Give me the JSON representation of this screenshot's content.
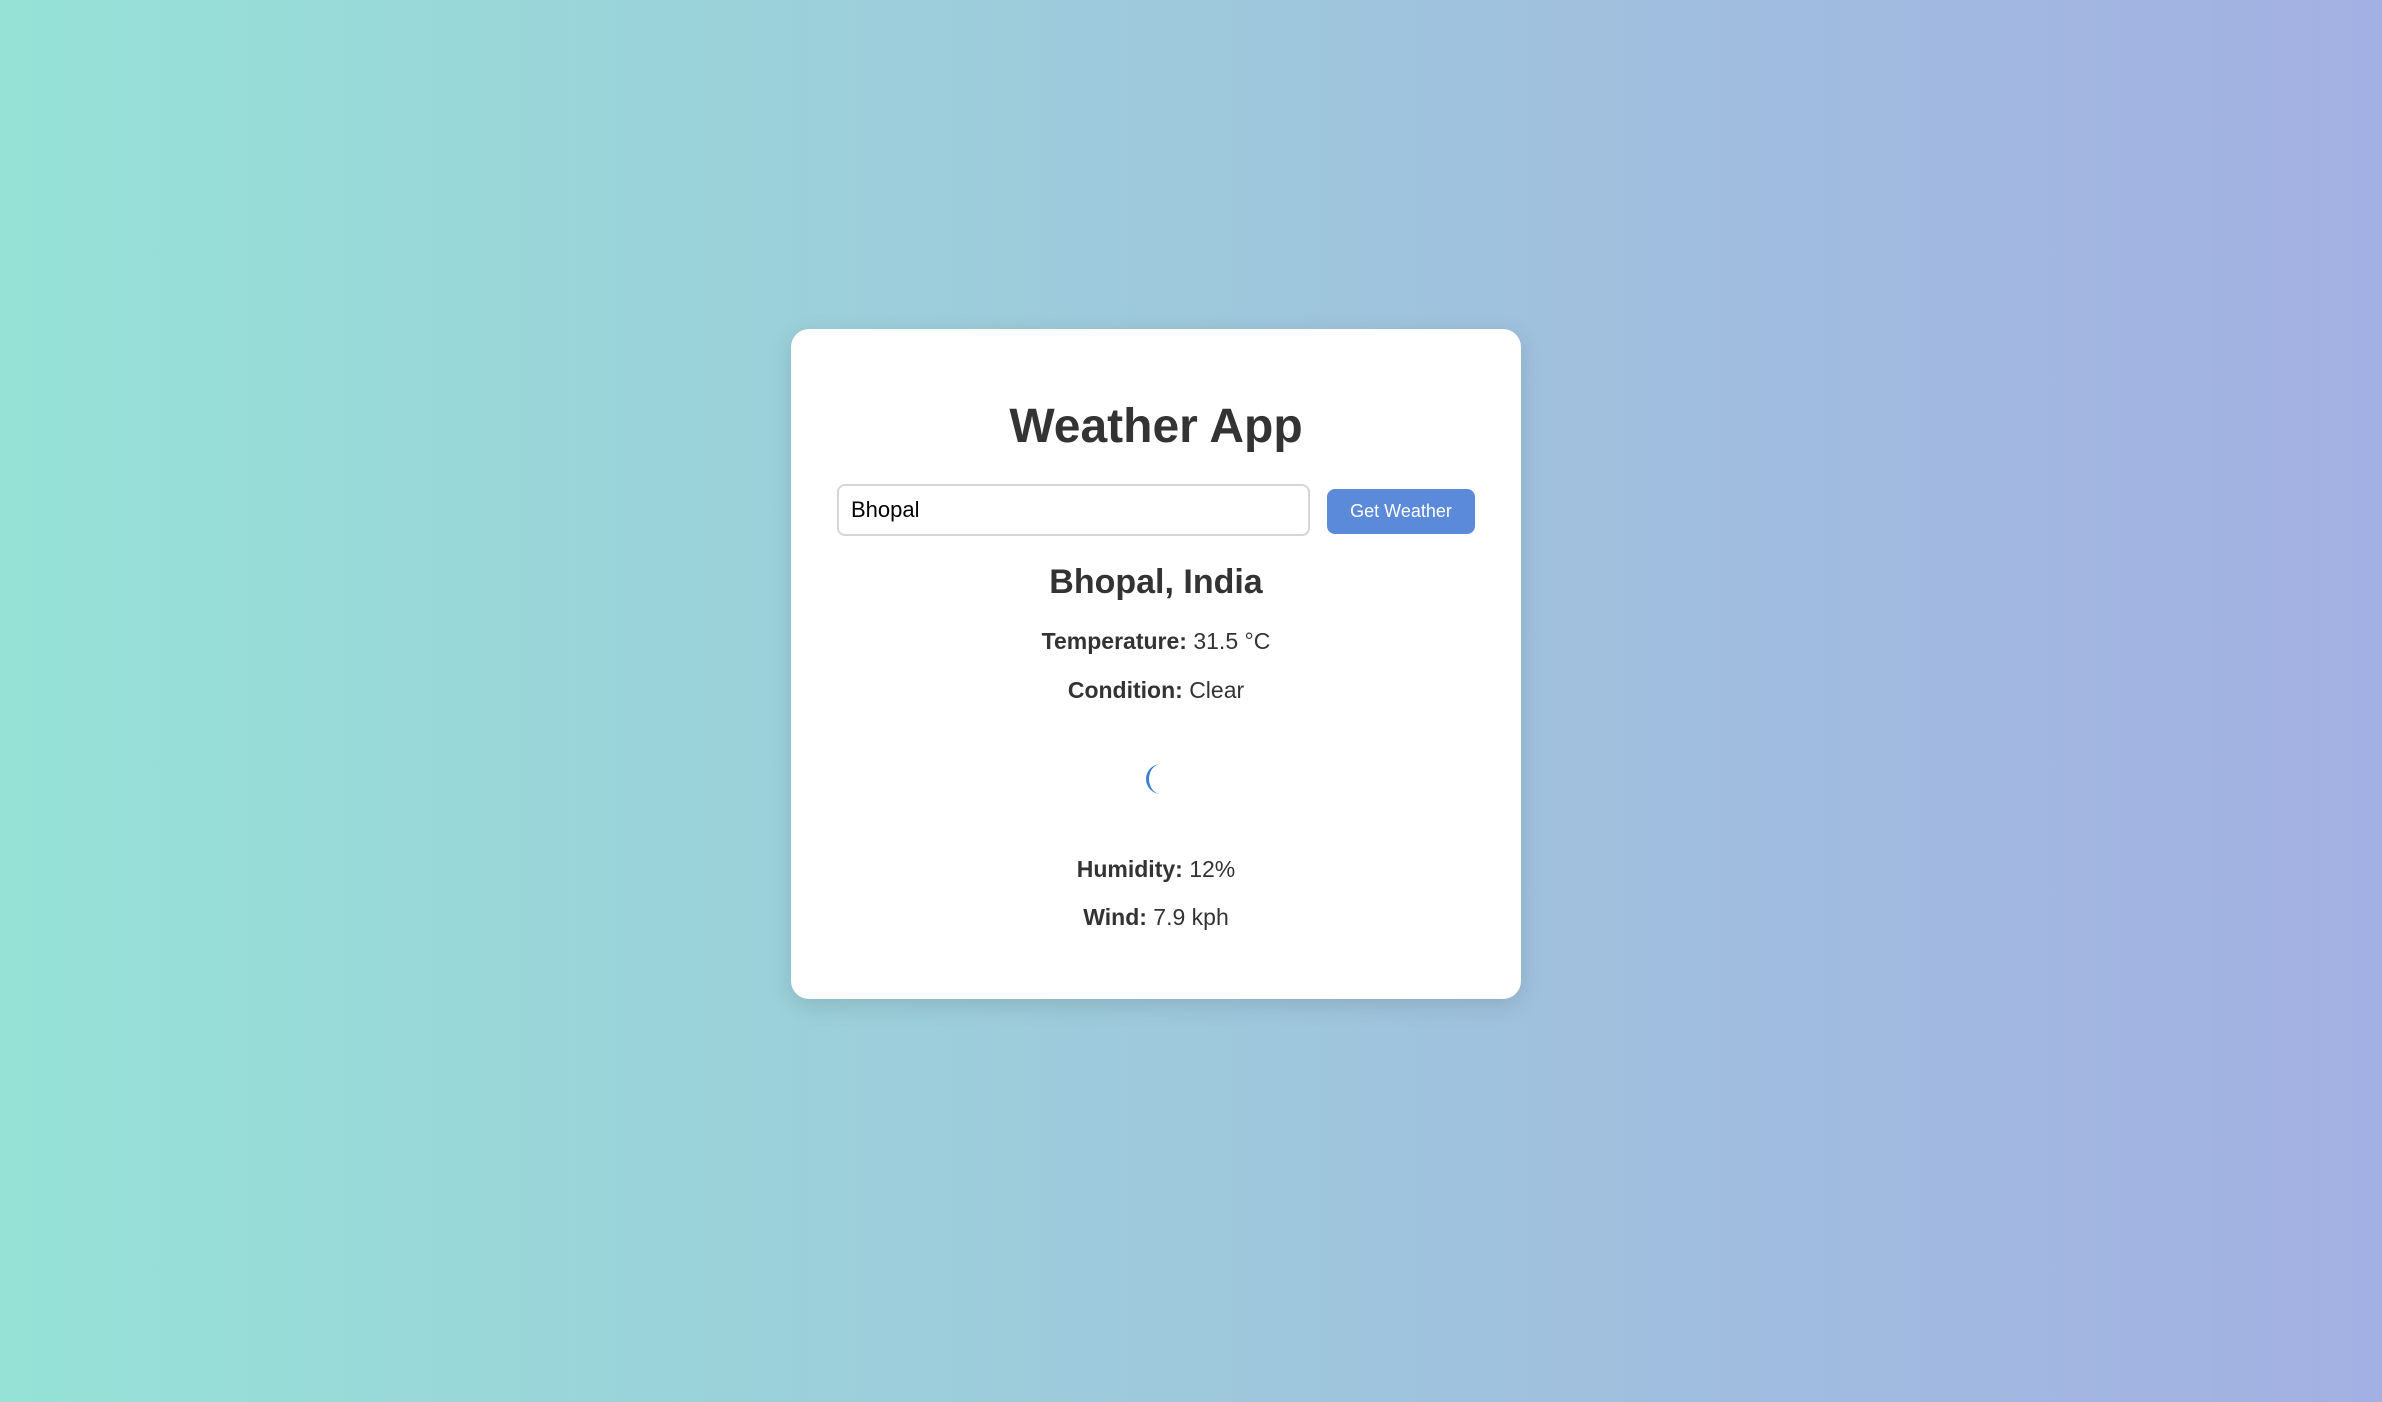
{
  "app": {
    "title": "Weather App"
  },
  "search": {
    "value": "Bhopal",
    "button_label": "Get Weather"
  },
  "weather": {
    "location": "Bhopal, India",
    "temperature_label": "Temperature:",
    "temperature_value": "31.5 °C",
    "condition_label": "Condition:",
    "condition_value": "Clear",
    "condition_icon": "moon-icon",
    "humidity_label": "Humidity:",
    "humidity_value": "12%",
    "wind_label": "Wind:",
    "wind_value": "7.9 kph"
  },
  "colors": {
    "button": "#5b8ada",
    "icon": "#3b7fd1",
    "text": "#333333"
  }
}
